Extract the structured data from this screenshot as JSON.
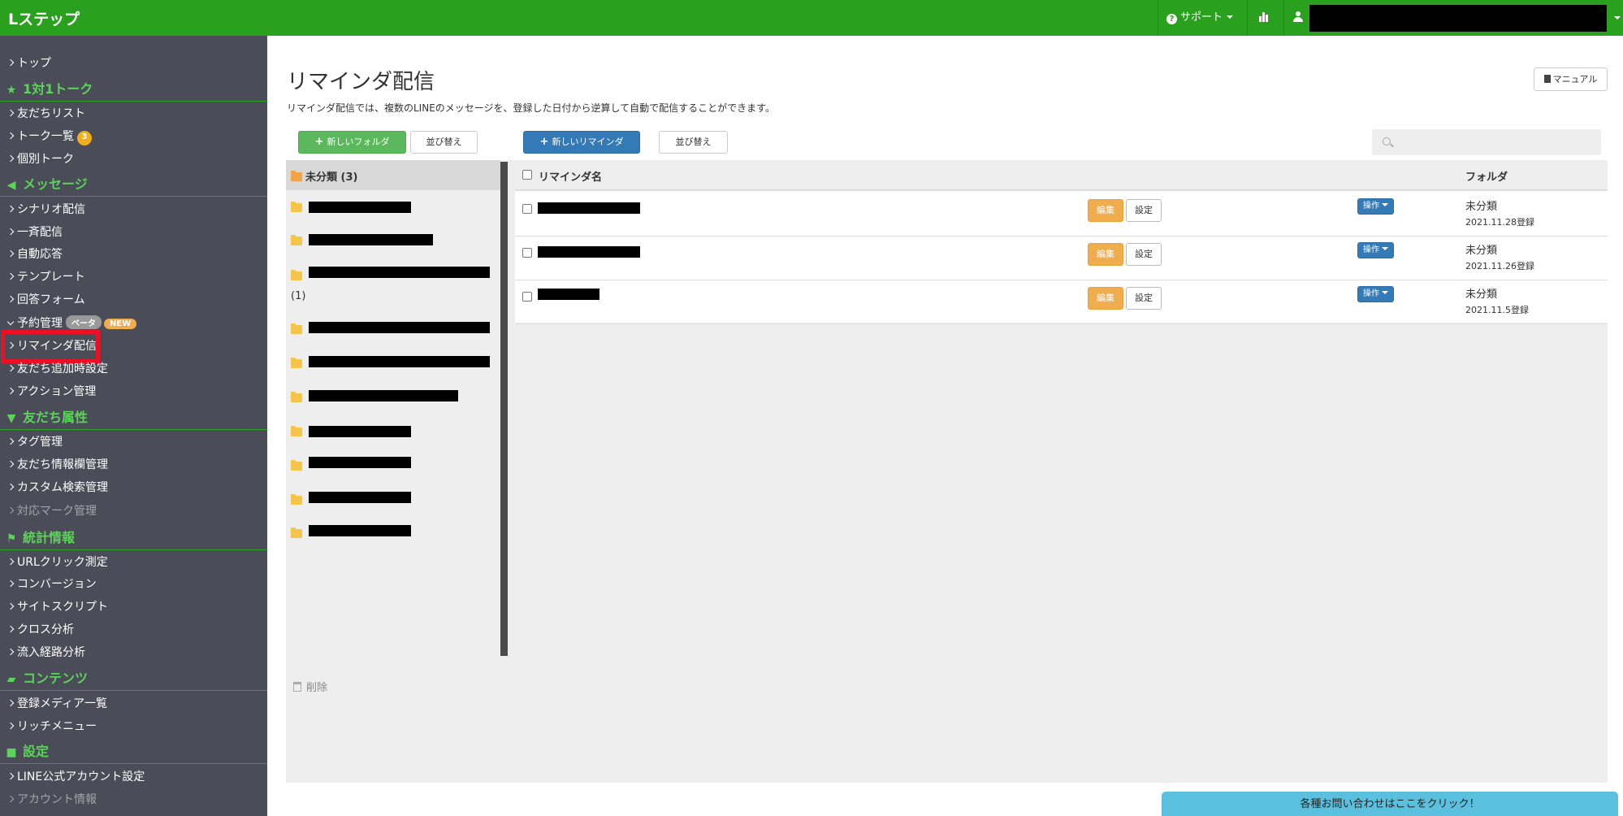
{
  "app": {
    "logo": "Lステップ"
  },
  "topbar": {
    "support_label": "サポート",
    "chart_icon": "bar-chart-icon",
    "user_icon": "user-icon"
  },
  "sidebar": {
    "top": "トップ",
    "talk_head": "1対1トーク",
    "friend_list": "友だちリスト",
    "talk_list": "トーク一覧",
    "talk_count": "3",
    "individual_talk": "個別トーク",
    "message_head": "メッセージ",
    "scenario": "シナリオ配信",
    "broadcast": "一斉配信",
    "auto_reply": "自動応答",
    "template": "テンプレート",
    "answer_form": "回答フォーム",
    "reservation": "予約管理",
    "beta_badge": "ベータ",
    "new_badge": "NEW",
    "reminder": "リマインダ配信",
    "friend_add": "友だち追加時設定",
    "action": "アクション管理",
    "attr_head": "友だち属性",
    "tag": "タグ管理",
    "friend_info": "友だち情報欄管理",
    "custom_search": "カスタム検索管理",
    "mark": "対応マーク管理",
    "stats_head": "統計情報",
    "url_click": "URLクリック測定",
    "conversion": "コンバージョン",
    "site_script": "サイトスクリプト",
    "cross": "クロス分析",
    "inflow": "流入経路分析",
    "contents_head": "コンテンツ",
    "media": "登録メディア一覧",
    "rich_menu": "リッチメニュー",
    "settings_head": "設定",
    "line_account": "LINE公式アカウント設定",
    "account_info": "アカウント情報"
  },
  "main": {
    "title": "リマインダ配信",
    "description": "リマインダ配信では、複数のLINEのメッセージを、登録した日付から逆算して自動で配信することができます。",
    "manual_label": "マニュアル",
    "new_folder": "新しいフォルダ",
    "sort_folder": "並び替え",
    "new_reminder": "新しいリマインダ",
    "sort_reminder": "並び替え",
    "search_placeholder": ""
  },
  "folders": {
    "active_label": "未分類 (3)",
    "folder3_suffix": "(1)",
    "delete_label": "削除"
  },
  "table": {
    "col_name": "リマインダ名",
    "col_folder": "フォルダ",
    "edit_label": "編集",
    "settings_label": "設定",
    "op_label": "操作",
    "rows": [
      {
        "folder": "未分類",
        "date": "2021.11.28登録"
      },
      {
        "folder": "未分類",
        "date": "2021.11.26登録"
      },
      {
        "folder": "未分類",
        "date": "2021.11.5登録"
      }
    ]
  },
  "contact_bar": "各種お問い合わせはここをクリック！",
  "colors": {
    "brand_green": "#29a01e",
    "sidebar_bg": "#4a4c57",
    "highlight_red": "#ef0f24"
  }
}
